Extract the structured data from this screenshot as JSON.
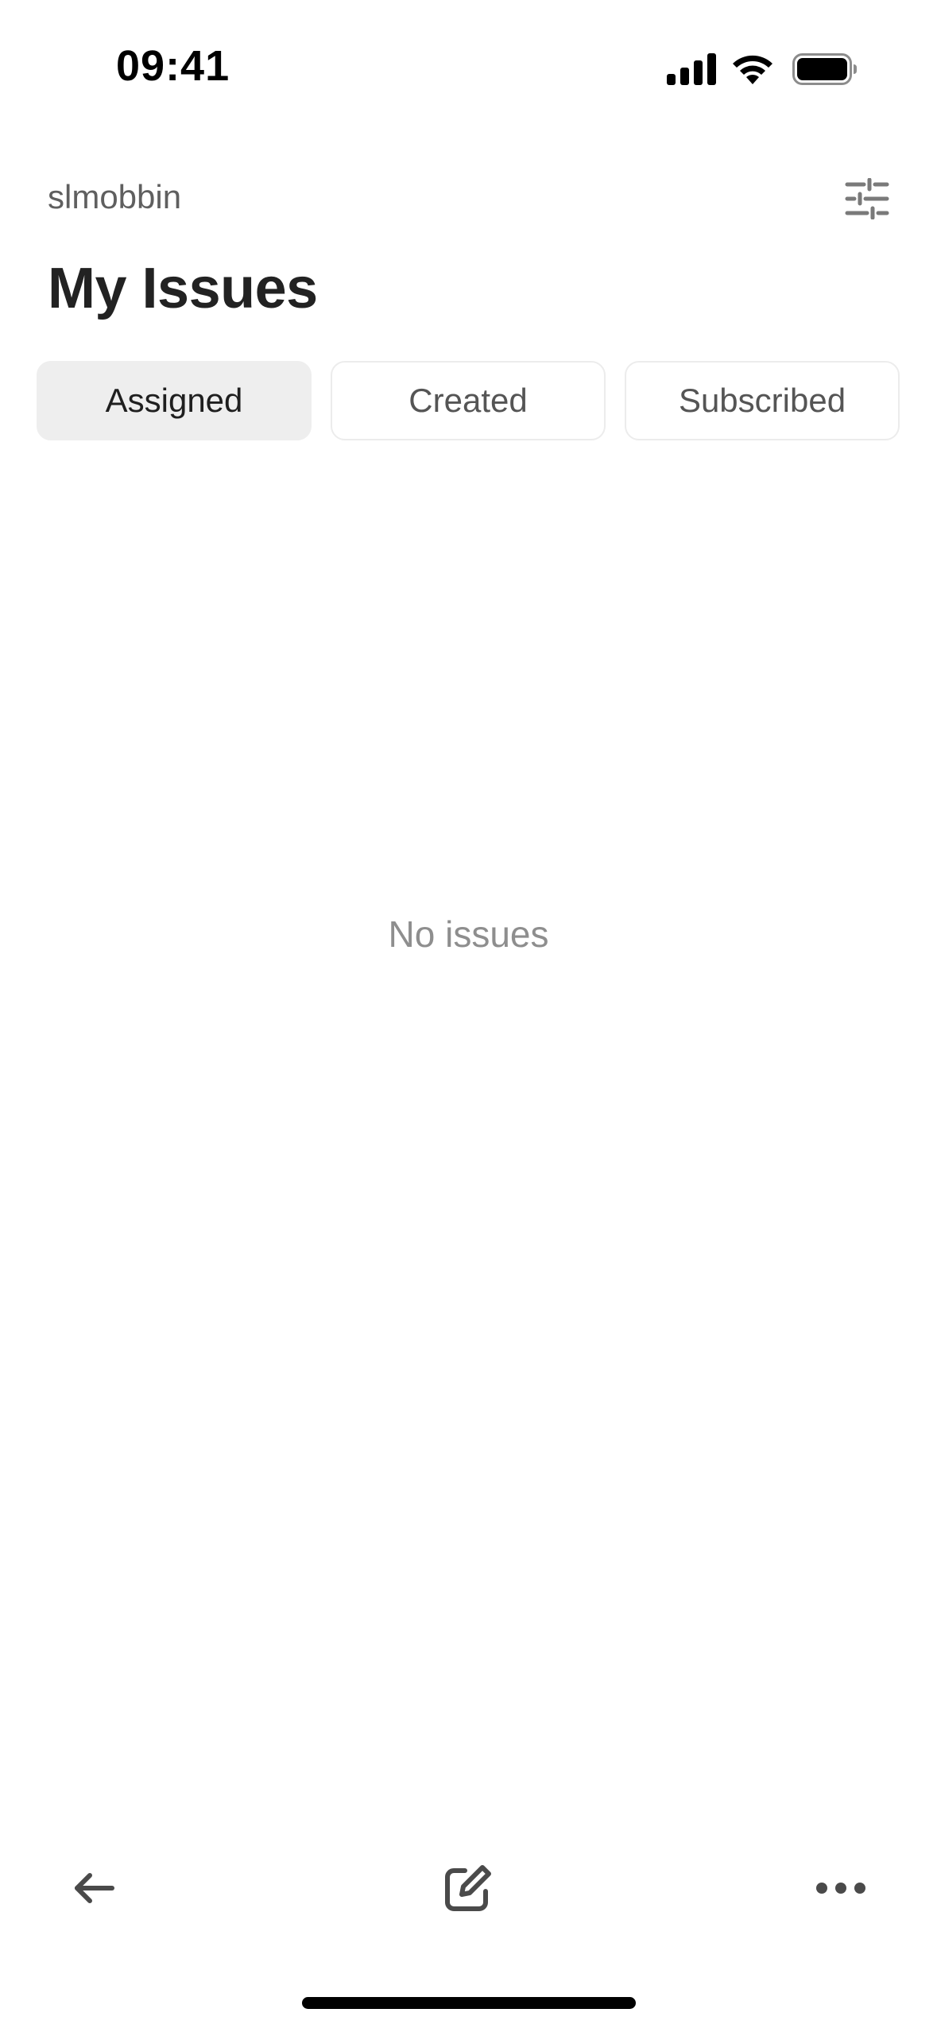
{
  "status_bar": {
    "time": "09:41",
    "icons": [
      "signal-icon",
      "wifi-icon",
      "battery-icon"
    ]
  },
  "header": {
    "workspace": "slmobbin",
    "title": "My Issues",
    "filter_icon": "sliders-icon"
  },
  "tabs": [
    {
      "label": "Assigned",
      "active": true
    },
    {
      "label": "Created",
      "active": false
    },
    {
      "label": "Subscribed",
      "active": false
    }
  ],
  "empty_state": {
    "text": "No issues"
  },
  "toolbar": {
    "icons": [
      "back-arrow-icon",
      "compose-icon",
      "more-icon"
    ]
  },
  "colors": {
    "text_primary": "#222222",
    "text_secondary": "#5f5f5f",
    "text_muted": "#8e8e8e",
    "tab_active_bg": "#eeeeee",
    "tab_border": "#ececec"
  }
}
